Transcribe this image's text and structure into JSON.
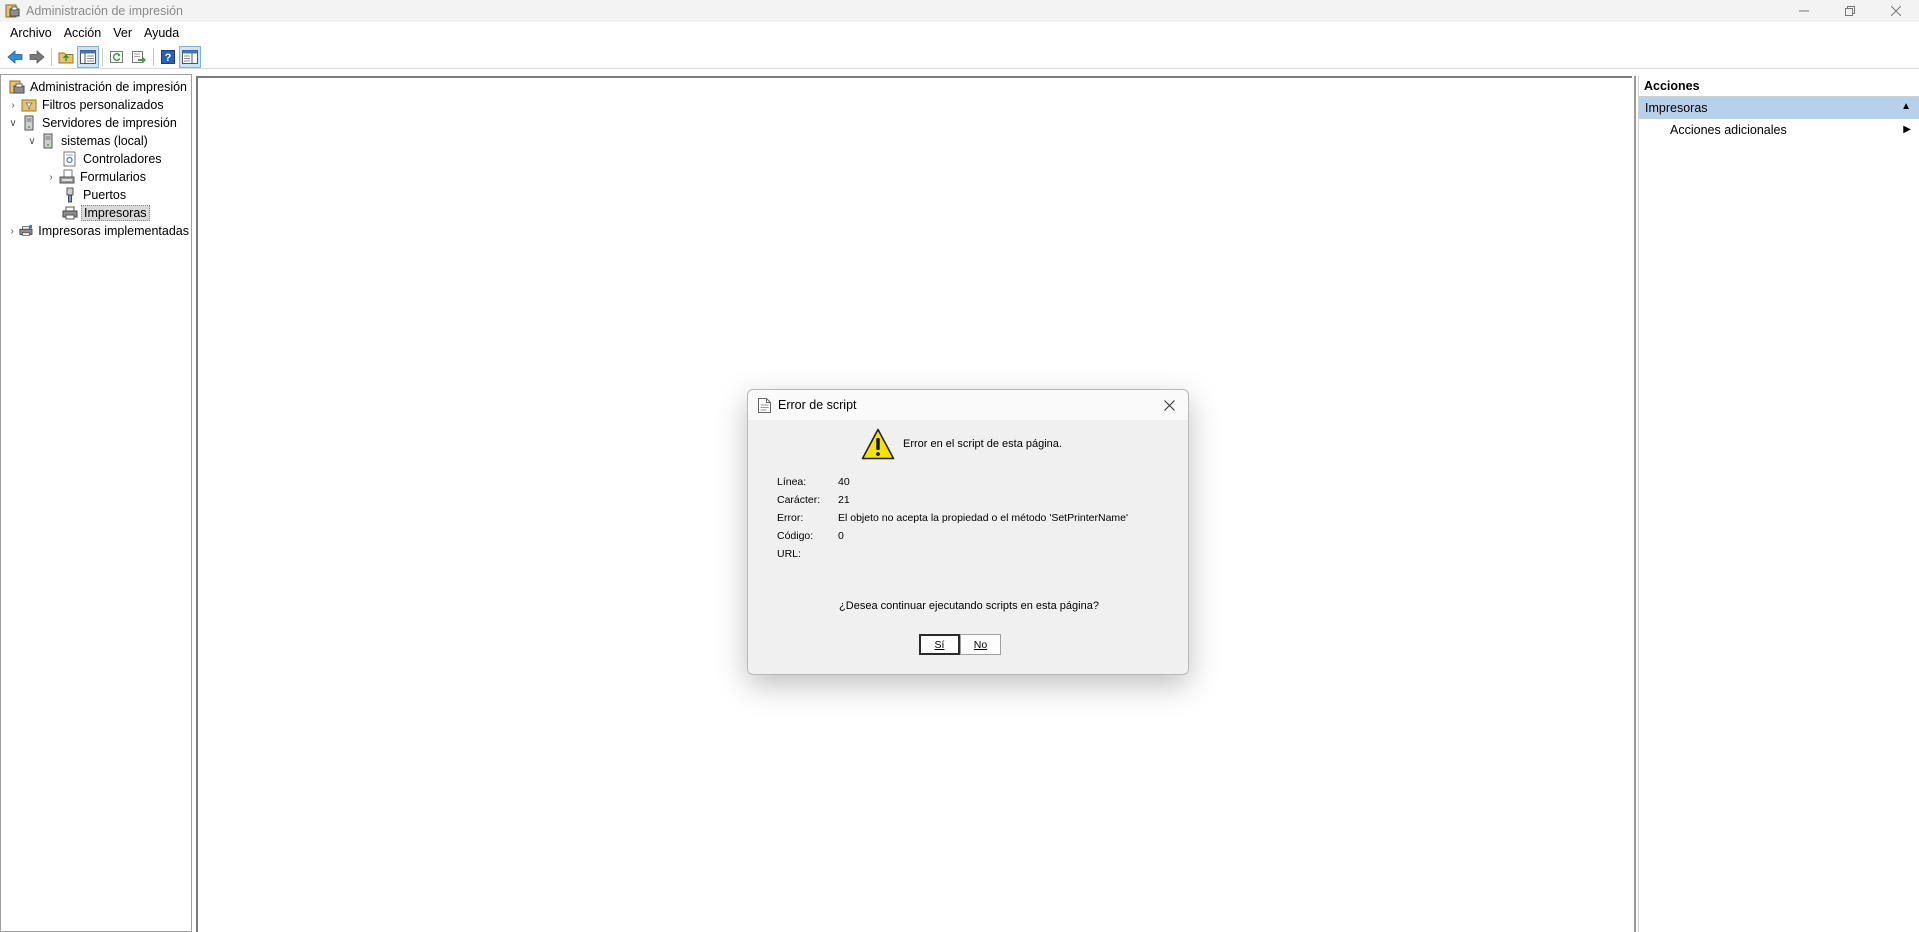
{
  "window": {
    "title": "Administración de impresión"
  },
  "menubar": [
    "Archivo",
    "Acción",
    "Ver",
    "Ayuda"
  ],
  "toolbar": {
    "icons": [
      "back-arrow-icon",
      "forward-arrow-icon",
      "up-folder-icon",
      "show-tree-icon",
      "refresh-icon",
      "export-icon",
      "help-icon",
      "show-actions-icon"
    ]
  },
  "tree": {
    "root": "Administración de impresión",
    "filters": "Filtros personalizados",
    "servers": "Servidores de impresión",
    "server": "sistemas (local)",
    "drivers": "Controladores",
    "forms": "Formularios",
    "ports": "Puertos",
    "printers": "Impresoras",
    "deployed": "Impresoras implementadas"
  },
  "actions": {
    "header": "Acciones",
    "section": "Impresoras",
    "item": "Acciones adicionales"
  },
  "dialog": {
    "title": "Error de script",
    "message": "Error en el script de esta página.",
    "fields": [
      {
        "key": "Línea:",
        "value": "40"
      },
      {
        "key": "Carácter:",
        "value": "21"
      },
      {
        "key": "Error:",
        "value": "El objeto no acepta la propiedad o el método 'SetPrinterName'"
      },
      {
        "key": "Código:",
        "value": "0"
      },
      {
        "key": "URL:",
        "value": ""
      }
    ],
    "question": "¿Desea continuar ejecutando scripts en esta página?",
    "yes": "Sí",
    "no": "No"
  },
  "colors": {
    "selection_blue": "#b8d1ea",
    "warning_yellow": "#f7e300"
  }
}
